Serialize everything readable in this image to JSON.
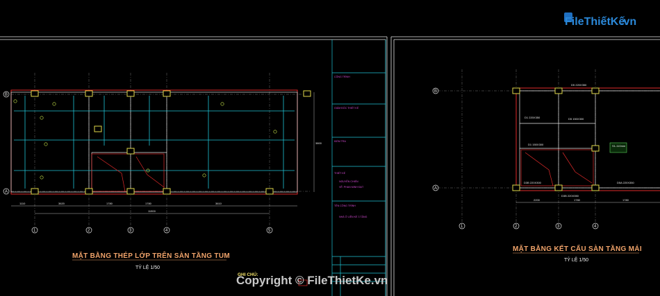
{
  "logo": {
    "brand": "FileThiếtKế",
    "tld": ".vn",
    "brand_color": "#2b88d8",
    "tld_color": "#2b88d8"
  },
  "colors": {
    "background": "#000000",
    "frame": "#e8e8e8",
    "slab_edge": "#e02a2a",
    "rebar": "#1fc3d6",
    "beam": "#e8e8e8",
    "column": "#e0d84a",
    "tag": "#c9e84a",
    "title": "#f0a36a"
  },
  "left_plan": {
    "title": "MẶT BẰNG THÉP LỚP TRÊN SÀN TẦNG TUM",
    "scale": "TỶ LỆ 1/50",
    "row_labels": [
      "B",
      "A"
    ],
    "col_labels": [
      "1",
      "2",
      "3",
      "4",
      "5"
    ],
    "dims": [
      "1110",
      "3620",
      "1780",
      "1780",
      "3610"
    ],
    "total_dim": "11900",
    "side_dim": "3800"
  },
  "title_block": {
    "rows": [
      "CÔNG TRÌNH",
      "GIÁM ĐỐC THIẾT KẾ",
      "KIỂM TRA",
      "THIẾT KẾ",
      "NGUYỄN CHIẾN",
      "VẼ: PHAN MINH ĐẠT",
      "TÊN CÔNG TRÌNH",
      "NHÀ Ở LIÊN KẾ 3 TẦNG"
    ]
  },
  "notes": {
    "label": "GHI CHÚ:"
  },
  "right_plan": {
    "title": "MẶT BẰNG KẾT CẤU SÀN TẦNG MÁI",
    "scale": "TỶ LỆ 1/50",
    "row_labels": [
      "B",
      "A"
    ],
    "col_labels": [
      "1",
      "2",
      "3",
      "4"
    ],
    "beam_tags": [
      "D5 220X350",
      "D5 150X300",
      "D1 150X300",
      "D3B 220X300",
      "D3B 220X350",
      "D5A 220X350",
      "D1 220X350"
    ],
    "dims": [
      "2200",
      "1780",
      "1780"
    ],
    "slab_tag": "S1-110mm"
  },
  "footer": {
    "copyright": "Copyright © FileThietKe.vn"
  }
}
